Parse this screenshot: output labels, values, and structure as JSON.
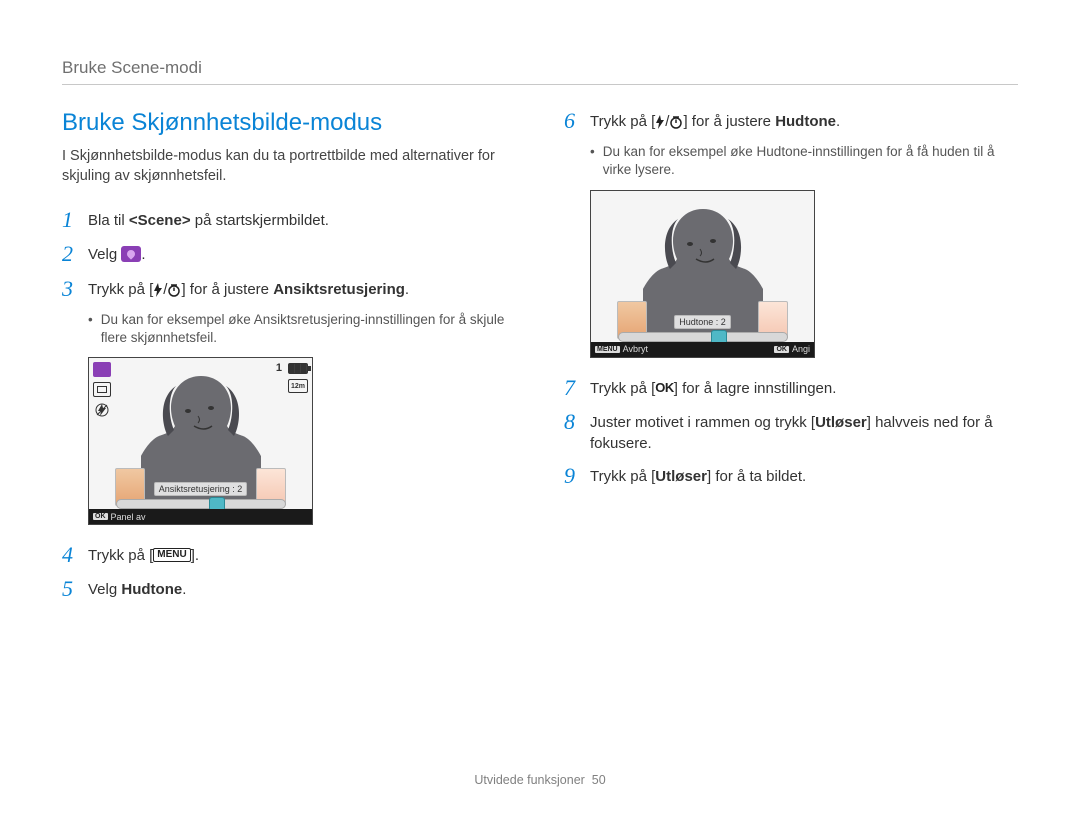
{
  "breadcrumb": "Bruke Scene-modi",
  "title": "Bruke Skjønnhetsbilde-modus",
  "intro": "I Skjønnhetsbilde-modus kan du ta portrettbilde med alternativer for skjuling av skjønnhetsfeil.",
  "steps": {
    "s1": {
      "num": "1",
      "pre": "Bla til ",
      "tag": "<Scene>",
      "post": " på startskjermbildet."
    },
    "s2": {
      "num": "2",
      "text": "Velg "
    },
    "s3": {
      "num": "3",
      "pre": "Trykk på [",
      "post": "] for å justere ",
      "bold": "Ansiktsretusjering",
      "end": "."
    },
    "s3b": "Du kan for eksempel øke Ansiktsretusjering-innstillingen for å skjule flere skjønnhetsfeil.",
    "s4": {
      "num": "4",
      "pre": "Trykk på [",
      "post": "]."
    },
    "s5": {
      "num": "5",
      "pre": "Velg ",
      "bold": "Hudtone",
      "end": "."
    },
    "s6": {
      "num": "6",
      "pre": "Trykk på [",
      "post": "] for å justere ",
      "bold": "Hudtone",
      "end": "."
    },
    "s6b": "Du kan for eksempel øke Hudtone-innstillingen for å få huden til å virke lysere.",
    "s7": {
      "num": "7",
      "pre": "Trykk på [",
      "post": "] for å lagre innstillingen."
    },
    "s8": {
      "num": "8",
      "pre": "Juster motivet i rammen og trykk [",
      "bold": "Utløser",
      "post": "] halvveis ned for å fokusere."
    },
    "s9": {
      "num": "9",
      "pre": "Trykk på [",
      "bold": "Utløser",
      "post": "] for å ta bildet."
    }
  },
  "screen1": {
    "count": "1",
    "size": "12m",
    "slider_label": "Ansiktsretusjering : 2",
    "footer_left": "Panel av",
    "knob_pos_pct": 55
  },
  "screen2": {
    "slider_label": "Hudtone : 2",
    "footer_left": "Avbryt",
    "footer_right": "Angi",
    "knob_pos_pct": 55
  },
  "labels": {
    "menu": "MENU",
    "ok": "OK"
  },
  "footer": {
    "section": "Utvidede funksjoner",
    "page": "50"
  }
}
